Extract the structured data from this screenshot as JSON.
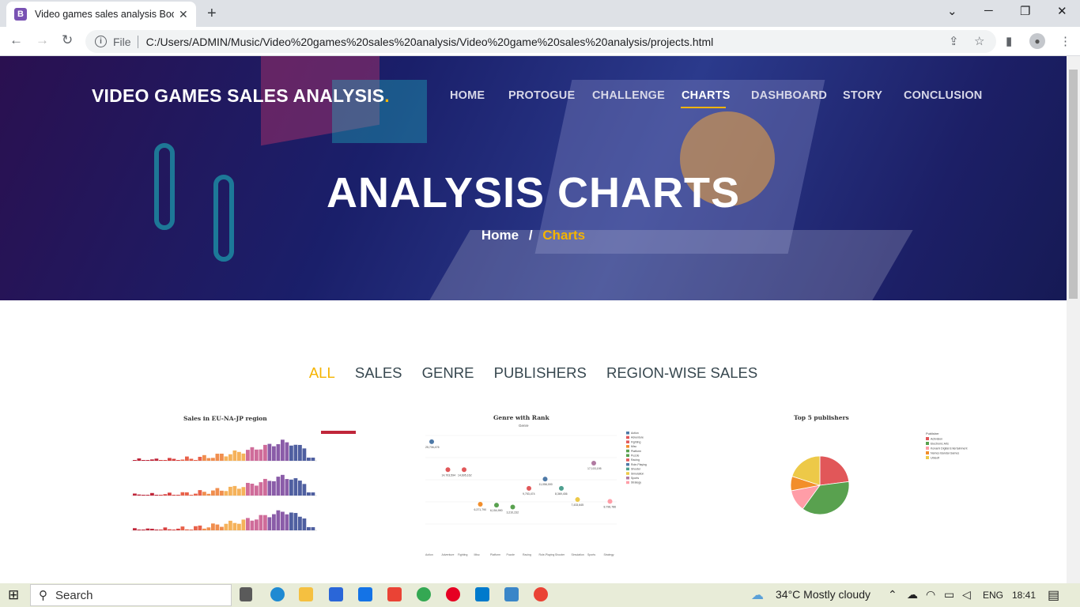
{
  "browser": {
    "tab_title": "Video games sales analysis Boots",
    "tab_favicon": "B",
    "file_label": "File",
    "url": "C:/Users/ADMIN/Music/Video%20games%20sales%20analysis/Video%20game%20sales%20analysis/projects.html"
  },
  "site": {
    "brand": "VIDEO GAMES SALES ANALYSIS",
    "brand_dot": ".",
    "nav": [
      "HOME",
      "PROTOGUE",
      "CHALLENGE",
      "CHARTS",
      "DASHBOARD",
      "STORY",
      "CONCLUSION"
    ],
    "active_nav": "CHARTS",
    "hero_title": "ANALYSIS CHARTS",
    "breadcrumb_home": "Home",
    "breadcrumb_sep": "/",
    "breadcrumb_current": "Charts",
    "filters": [
      "ALL",
      "SALES",
      "GENRE",
      "PUBLISHERS",
      "REGION-WISE SALES"
    ],
    "active_filter": "ALL",
    "accent_color": "#f5b400"
  },
  "charts": {
    "region_title": "Sales in EU-NA-JP region",
    "genre_title": "Genre with Rank",
    "genre_subtitle": "Genre",
    "publishers_title": "Top 5 publishers"
  },
  "chart_data": [
    {
      "type": "bar",
      "title": "Sales in EU-NA-JP region",
      "note": "thumbnail, values illegible"
    },
    {
      "type": "scatter",
      "title": "Genre with Rank",
      "subtitle": "Genre",
      "categories": [
        "Action",
        "Adventure",
        "Fighting",
        "Misc",
        "Platform",
        "Puzzle",
        "Racing",
        "Role-Playing",
        "Shooter",
        "Simulation",
        "Sports",
        "Strategy"
      ],
      "data_labels": [
        "25,706,476",
        "14,703,594",
        "14,695,162",
        "6,371,790",
        "6,154,990",
        "3,210,232",
        "9,753,474",
        "11,056,000",
        "8,369,436",
        "7,433,645",
        "17,103,195",
        "8,796,786"
      ]
    },
    {
      "type": "pie",
      "title": "Top 5 publishers",
      "legend_title": "Publisher",
      "categories": [
        "Activision",
        "Electronic Arts",
        "Konami Digital Entertainment",
        "Namco Bandai Games",
        "Ubisoft"
      ],
      "colors": [
        "#e15759",
        "#59a14f",
        "#ff9da7",
        "#f28e2b",
        "#edc948"
      ]
    }
  ],
  "taskbar": {
    "search": "Search",
    "weather": "34°C  Mostly cloudy",
    "lang": "ENG",
    "time": "18:41"
  }
}
